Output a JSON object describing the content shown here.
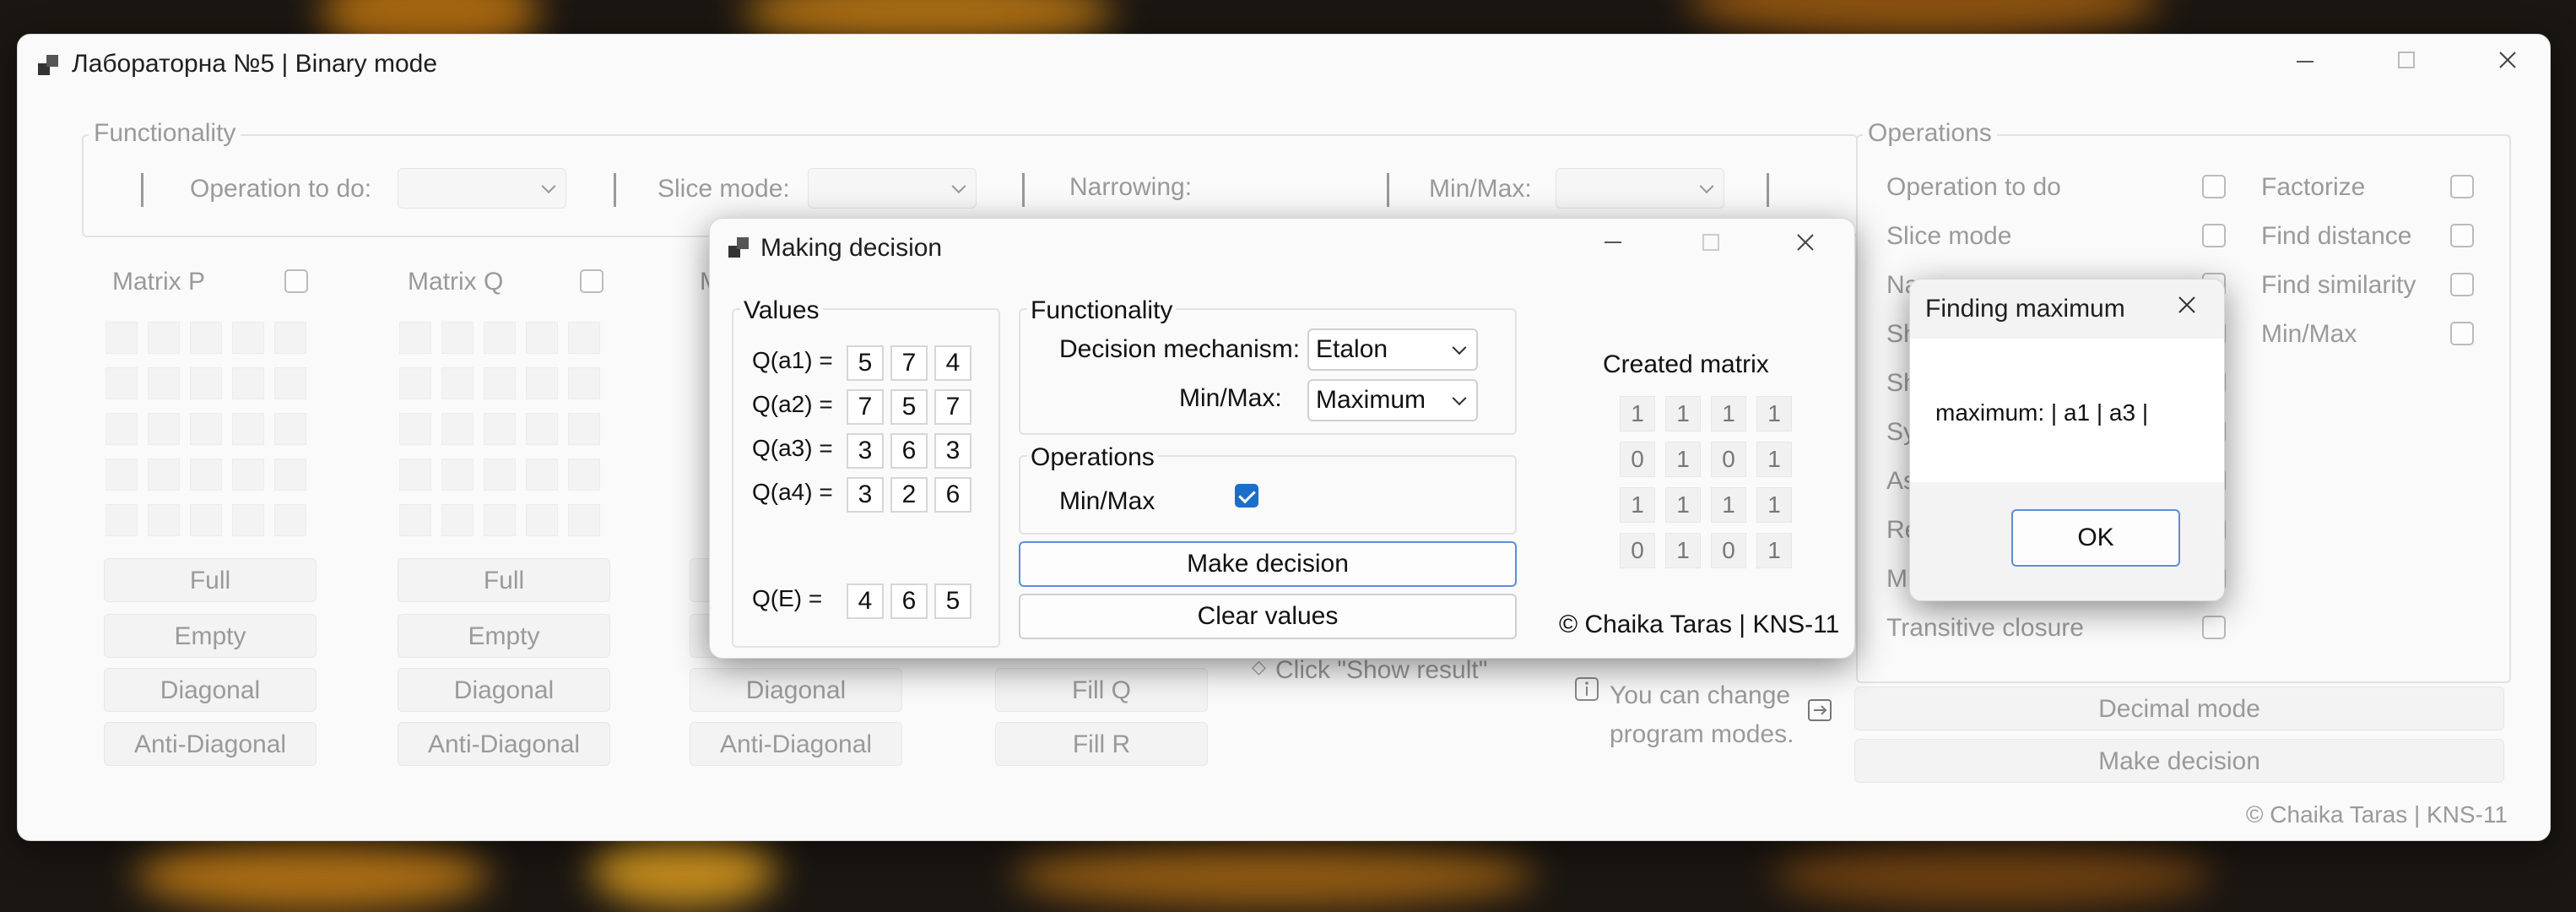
{
  "main": {
    "title": "Лабораторна №5 | Binary mode",
    "functionality": {
      "label": "Functionality",
      "operation_label": "Operation to do:",
      "slice_label": "Slice mode:",
      "narrowing_label": "Narrowing:",
      "minmax_label": "Min/Max:"
    },
    "matrices": [
      {
        "label": "Matrix P"
      },
      {
        "label": "Matrix Q"
      },
      {
        "label": "M"
      }
    ],
    "fill_buttons": {
      "full": "Full",
      "empty": "Empty",
      "diagonal": "Diagonal",
      "anti_diagonal": "Anti-Diagonal",
      "fill_q": "Fill Q",
      "fill_r": "Fill R"
    },
    "hint_show_result": "Click \"Show result\"",
    "info_text": "You can change program modes.",
    "operations": {
      "label": "Operations",
      "left": [
        "Operation to do",
        "Slice mode",
        "Na",
        "Sh",
        "Sh",
        "Sy",
        "As",
        "Re",
        "M",
        "Transitive closure"
      ],
      "right": [
        "Factorize",
        "Find distance",
        "Find similarity",
        "Min/Max"
      ]
    },
    "decimal_mode_button": "Decimal mode",
    "make_decision_button": "Make decision",
    "footer": "© Chaika Taras | KNS-11"
  },
  "decision": {
    "title": "Making decision",
    "values_label": "Values",
    "rows": [
      {
        "label": "Q(a1) =",
        "values": [
          "5",
          "7",
          "4"
        ]
      },
      {
        "label": "Q(a2) =",
        "values": [
          "7",
          "5",
          "7"
        ]
      },
      {
        "label": "Q(a3) =",
        "values": [
          "3",
          "6",
          "3"
        ]
      },
      {
        "label": "Q(a4) =",
        "values": [
          "3",
          "2",
          "6"
        ]
      }
    ],
    "etalon": {
      "label": "Q(E)  =",
      "values": [
        "4",
        "6",
        "5"
      ]
    },
    "functionality_label": "Functionality",
    "mechanism_label": "Decision mechanism:",
    "mechanism_value": "Etalon",
    "minmax_label": "Min/Max:",
    "minmax_value": "Maximum",
    "operations_label": "Operations",
    "minmax_op_label": "Min/Max",
    "minmax_checked": true,
    "make_decision_button": "Make decision",
    "clear_values_button": "Clear values",
    "created_matrix_label": "Created matrix",
    "created_matrix": [
      [
        "1",
        "1",
        "1",
        "1"
      ],
      [
        "0",
        "1",
        "0",
        "1"
      ],
      [
        "1",
        "1",
        "1",
        "1"
      ],
      [
        "0",
        "1",
        "0",
        "1"
      ]
    ],
    "footer": "© Chaika Taras | KNS-11"
  },
  "max_dialog": {
    "title": "Finding maximum",
    "message": "maximum: | a1 | a3 |",
    "ok_button": "OK"
  },
  "icons": [
    "app-icon",
    "minimize-icon",
    "maximize-icon",
    "close-icon",
    "chevron-down-icon",
    "info-icon",
    "arrow-right-icon",
    "checkmark-icon"
  ]
}
